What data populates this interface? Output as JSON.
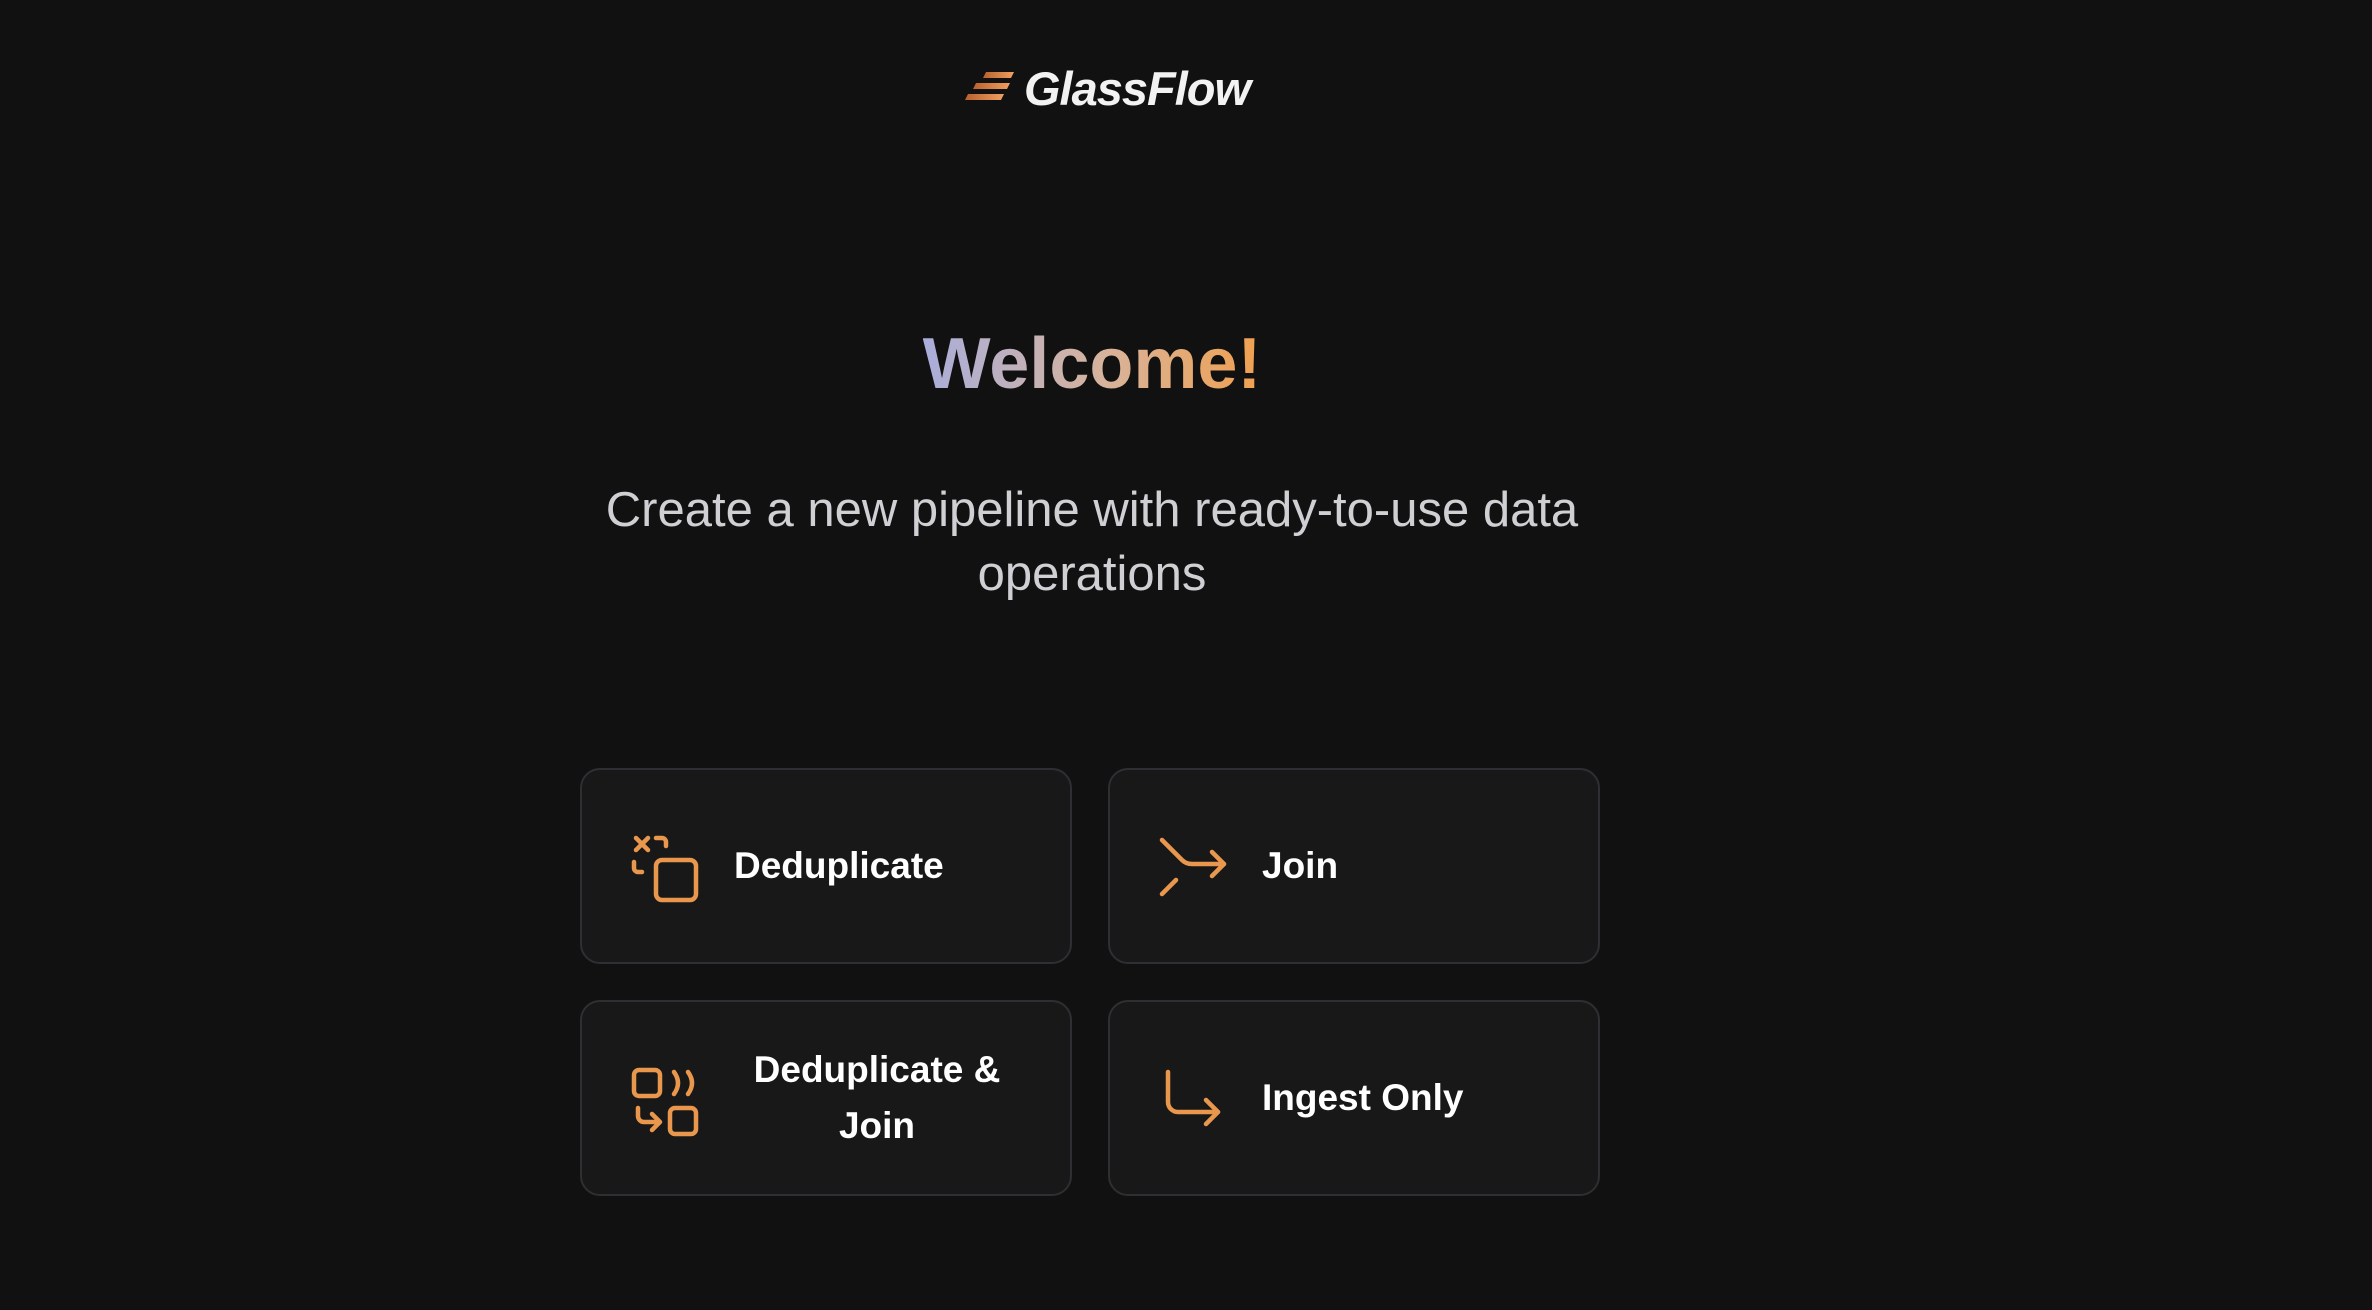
{
  "brand": {
    "name": "GlassFlow",
    "accent_color": "#E8974C"
  },
  "hero": {
    "title": "Welcome!",
    "subtitle": "Create a new pipeline with ready-to-use data operations"
  },
  "operations": [
    {
      "label": "Deduplicate",
      "icon": "deduplicate-icon"
    },
    {
      "label": "Join",
      "icon": "join-icon"
    },
    {
      "label": "Deduplicate & Join",
      "icon": "deduplicate-join-icon"
    },
    {
      "label": "Ingest Only",
      "icon": "ingest-icon"
    }
  ]
}
